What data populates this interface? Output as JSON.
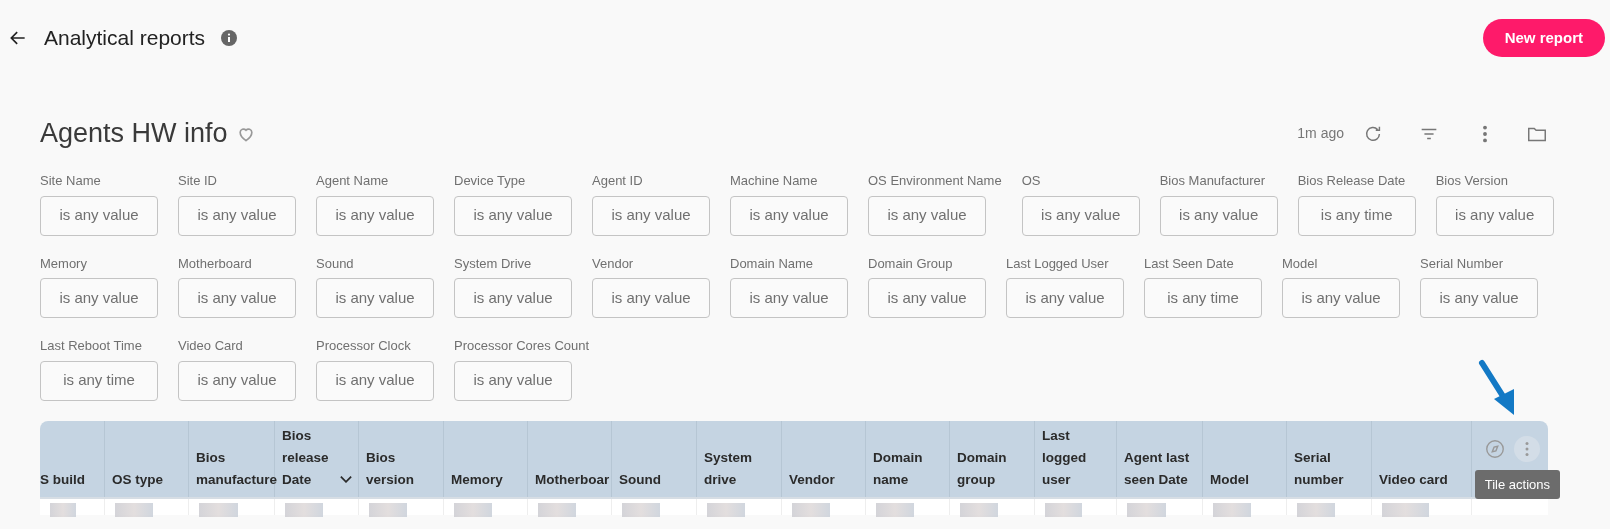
{
  "header": {
    "title": "Analytical reports",
    "button": "New report"
  },
  "report": {
    "title": "Agents HW info",
    "favorite": false,
    "updated": "1m ago"
  },
  "filter_rows": [
    [
      {
        "label": "Site Name",
        "value": "is any value"
      },
      {
        "label": "Site ID",
        "value": "is any value"
      },
      {
        "label": "Agent Name",
        "value": "is any value"
      },
      {
        "label": "Device Type",
        "value": "is any value"
      },
      {
        "label": "Agent ID",
        "value": "is any value"
      },
      {
        "label": "Machine Name",
        "value": "is any value"
      },
      {
        "label": "OS Environment Name",
        "value": "is any value"
      },
      {
        "label": "OS",
        "value": "is any value"
      },
      {
        "label": "Bios Manufacturer",
        "value": "is any value"
      },
      {
        "label": "Bios Release Date",
        "value": "is any time"
      },
      {
        "label": "Bios Version",
        "value": "is any value"
      }
    ],
    [
      {
        "label": "Memory",
        "value": "is any value"
      },
      {
        "label": "Motherboard",
        "value": "is any value"
      },
      {
        "label": "Sound",
        "value": "is any value"
      },
      {
        "label": "System Drive",
        "value": "is any value"
      },
      {
        "label": "Vendor",
        "value": "is any value"
      },
      {
        "label": "Domain Name",
        "value": "is any value"
      },
      {
        "label": "Domain Group",
        "value": "is any value"
      },
      {
        "label": "Last Logged User",
        "value": "is any value"
      },
      {
        "label": "Last Seen Date",
        "value": "is any time"
      },
      {
        "label": "Model",
        "value": "is any value"
      },
      {
        "label": "Serial Number",
        "value": "is any value"
      }
    ],
    [
      {
        "label": "Last Reboot Time",
        "value": "is any time"
      },
      {
        "label": "Video Card",
        "value": "is any value"
      },
      {
        "label": "Processor Clock",
        "value": "is any value"
      },
      {
        "label": "Processor Cores Count",
        "value": "is any value"
      }
    ]
  ],
  "table": {
    "columns": [
      {
        "label": "S build",
        "sorted": false
      },
      {
        "label": "OS type",
        "sorted": false
      },
      {
        "label": "Bios manufacture",
        "sorted": false
      },
      {
        "label": "Bios release Date",
        "sorted": true
      },
      {
        "label": "Bios version",
        "sorted": false
      },
      {
        "label": "Memory",
        "sorted": false
      },
      {
        "label": "Motherboar",
        "sorted": false
      },
      {
        "label": "Sound",
        "sorted": false
      },
      {
        "label": "System drive",
        "sorted": false
      },
      {
        "label": "Vendor",
        "sorted": false
      },
      {
        "label": "Domain name",
        "sorted": false
      },
      {
        "label": "Domain group",
        "sorted": false
      },
      {
        "label": "Last logged user",
        "sorted": false
      },
      {
        "label": "Agent last seen Date",
        "sorted": false
      },
      {
        "label": "Model",
        "sorted": false
      },
      {
        "label": "Serial number",
        "sorted": false
      },
      {
        "label": "Video card",
        "sorted": false
      }
    ],
    "tooltip": "Tile actions"
  }
}
